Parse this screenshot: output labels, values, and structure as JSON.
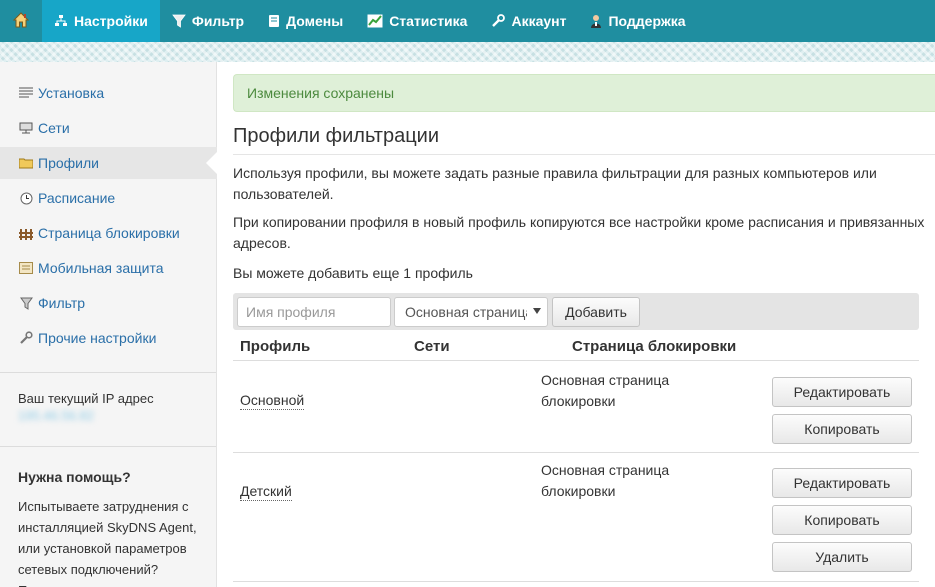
{
  "nav": {
    "home_icon": "home-icon",
    "items": [
      {
        "label": "Настройки",
        "icon": "sitemap-icon",
        "active": true
      },
      {
        "label": "Фильтр",
        "icon": "filter-icon"
      },
      {
        "label": "Домены",
        "icon": "book-icon"
      },
      {
        "label": "Статистика",
        "icon": "chart-icon"
      },
      {
        "label": "Аккаунт",
        "icon": "wrench-icon"
      },
      {
        "label": "Поддержка",
        "icon": "person-icon"
      }
    ]
  },
  "sidebar": {
    "items": [
      {
        "label": "Установка",
        "icon": "list-icon"
      },
      {
        "label": "Сети",
        "icon": "network-icon"
      },
      {
        "label": "Профили",
        "icon": "folder-icon",
        "active": true
      },
      {
        "label": "Расписание",
        "icon": "clock-icon"
      },
      {
        "label": "Страница блокировки",
        "icon": "fence-icon"
      },
      {
        "label": "Мобильная защита",
        "icon": "mobile-icon"
      },
      {
        "label": "Фильтр",
        "icon": "filter-icon"
      },
      {
        "label": "Прочие настройки",
        "icon": "wrench-icon"
      }
    ],
    "ip_label": "Ваш текущий IP адрес",
    "ip_value": "195.46.56.82",
    "help_title": "Нужна помощь?",
    "help_text": "Испытываете затруднения с инсталляцией SkyDNS Agent, или установкой параметров сетевых подключений? Познакомьтесь с"
  },
  "main": {
    "alert": "Изменения сохранены",
    "title": "Профили фильтрации",
    "para1": "Используя профили, вы можете задать разные правила фильтрации для разных компьютеров или пользователей.",
    "para2": "При копировании профиля в новый профиль копируются все настройки кроме расписания и привязанных адресов.",
    "para3": "Вы можете добавить еще 1 профиль",
    "form": {
      "name_placeholder": "Имя профиля",
      "select_value": "Основная страница блокировки",
      "add_button": "Добавить"
    },
    "table": {
      "headers": [
        "Профиль",
        "Сети",
        "Страница блокировки"
      ],
      "rows": [
        {
          "name": "Основной",
          "networks": "",
          "block_page": "Основная страница блокировки",
          "actions": [
            "Редактировать",
            "Копировать"
          ]
        },
        {
          "name": "Детский",
          "networks": "",
          "block_page": "Основная страница блокировки",
          "actions": [
            "Редактировать",
            "Копировать",
            "Удалить"
          ]
        }
      ]
    }
  },
  "colors": {
    "nav_bg": "#1f8ea0",
    "nav_active": "#17a6c8",
    "link": "#2a6fa8",
    "alert_bg": "#dff0d8",
    "alert_text": "#4c8a3e"
  }
}
